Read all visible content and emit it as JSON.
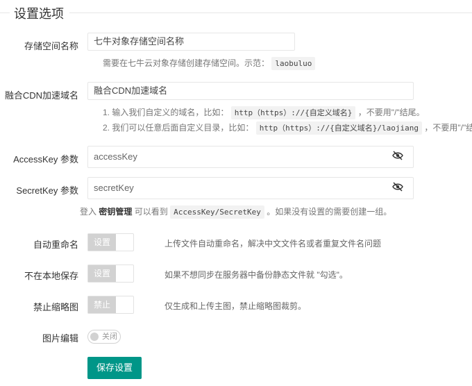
{
  "title": "设置选项",
  "fields": {
    "bucket": {
      "label": "存储空间名称",
      "value": "七牛对象存储空间名称",
      "help_text": "需要在七牛云对象存储创建存储空间。示范：",
      "help_code": "laobuluo"
    },
    "domain": {
      "label": "融合CDN加速域名",
      "value": "融合CDN加速域名",
      "help1_pre": "1. 输入我们自定义的域名，比如：",
      "help1_code": "http（https）://{自定义域名}",
      "help1_post": "，不要用\"/\"结尾。",
      "help2_pre": "2. 我们可以任意后面自定义目录，比如：",
      "help2_code": "http（https）://{自定义域名}/laojiang",
      "help2_post": "，不要用\"/\"结尾。"
    },
    "accesskey": {
      "label": "AccessKey 参数",
      "value": "accessKey"
    },
    "secretkey": {
      "label": "SecretKey 参数",
      "value": "secretKey",
      "help_pre": "登入",
      "help_link": "密钥管理",
      "help_mid": "可以看到",
      "help_code": "AccessKey/SecretKey",
      "help_post": "。如果没有设置的需要创建一组。"
    }
  },
  "options": {
    "auto_rename": {
      "label": "自动重命名",
      "checkbox_text": "设置",
      "description": "上传文件自动重命名，解决中文文件名或者重复文件名问题"
    },
    "no_local": {
      "label": "不在本地保存",
      "checkbox_text": "设置",
      "description": "如果不想同步在服务器中备份静态文件就 \"勾选\"。"
    },
    "no_thumb": {
      "label": "禁止缩略图",
      "checkbox_text": "禁止",
      "description": "仅生成和上传主图，禁止缩略图裁剪。"
    },
    "image_edit": {
      "label": "图片编辑",
      "switch_text": "关闭"
    }
  },
  "save_label": "保存设置",
  "icons": {
    "eye_slash": "eye-slash-icon"
  },
  "colors": {
    "primary": "#009688",
    "checkbox_gray": "#d2d2d2"
  }
}
